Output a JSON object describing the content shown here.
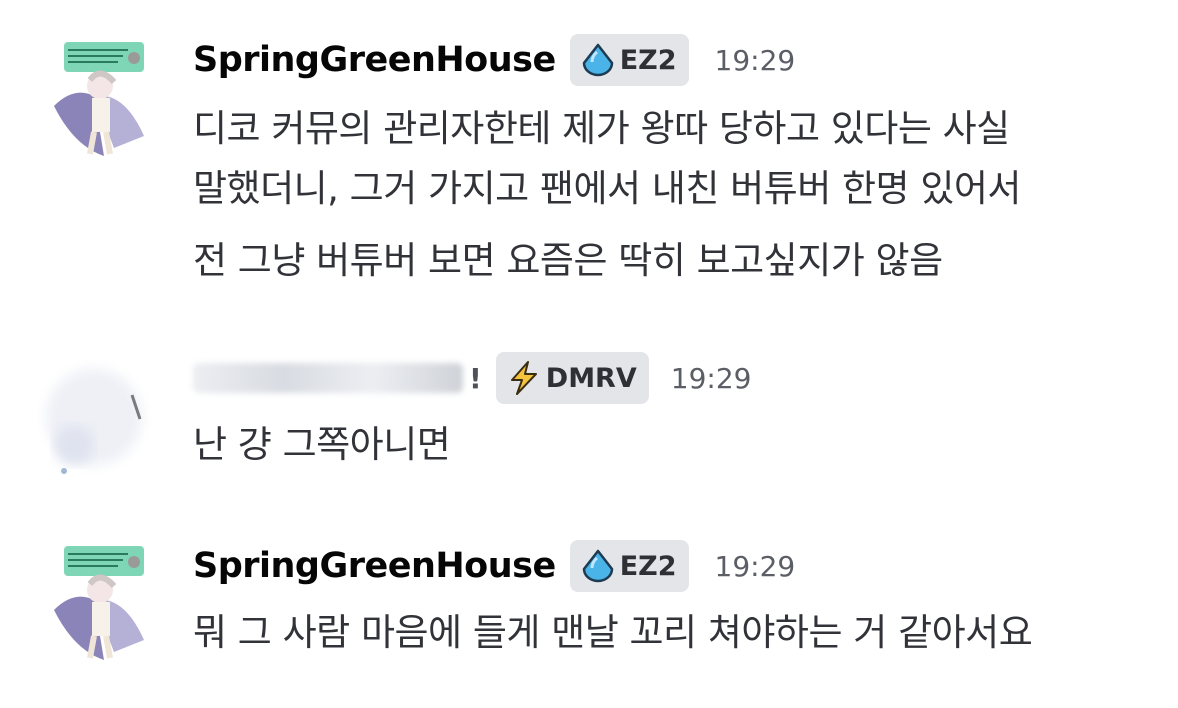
{
  "messages": [
    {
      "username": "SpringGreenHouse",
      "tag": {
        "icon": "water-drop-icon",
        "label": "EZ2"
      },
      "time": "19:29",
      "lines": [
        "디코 커뮤의 관리자한테 제가 왕따 당하고 있다는 사실",
        "말했더니, 그거 가지고 팬에서 내친 버튜버 한명 있어서",
        "전 그냥 버튜버 보면 요즘은 딱히 보고싶지가 않음"
      ]
    },
    {
      "username": "",
      "tag": {
        "icon": "lightning-bolt-icon",
        "label": "DMRV"
      },
      "time": "19:29",
      "lines": [
        "난 걍 그쪽아니면"
      ]
    },
    {
      "username": "SpringGreenHouse",
      "tag": {
        "icon": "water-drop-icon",
        "label": "EZ2"
      },
      "time": "19:29",
      "lines": [
        "뭐 그 사람 마음에 들게 맨날 꼬리 쳐야하는 거 같아서요"
      ]
    }
  ]
}
